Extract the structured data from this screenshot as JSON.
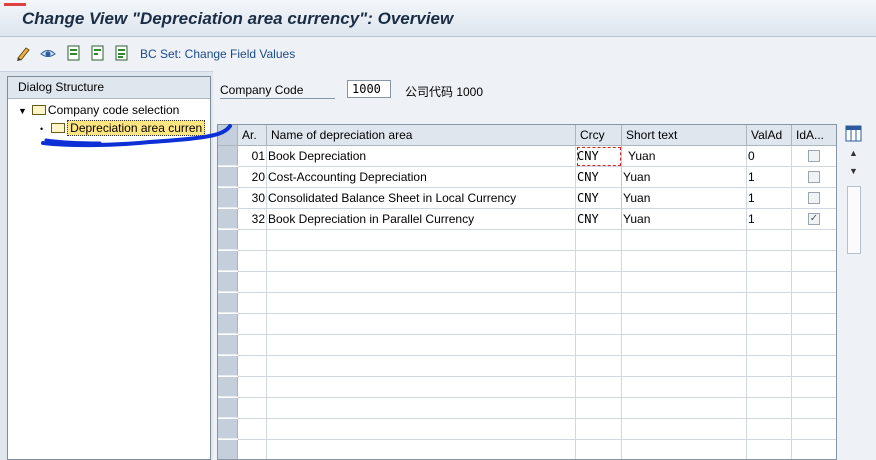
{
  "window": {
    "title": "Change View \"Depreciation area currency\": Overview"
  },
  "toolbar": {
    "bc_set_label": "BC Set: Change Field Values"
  },
  "tree": {
    "header": "Dialog Structure",
    "items": [
      {
        "label": "Company code selection",
        "expanded": true,
        "level": 0
      },
      {
        "label": "Depreciation area curren",
        "selected": true,
        "level": 1
      }
    ]
  },
  "company": {
    "label": "Company Code",
    "value": "1000",
    "name": "公司代码 1000"
  },
  "table": {
    "columns": [
      "Ar.",
      "Name of depreciation area",
      "Crcy",
      "Short text",
      "ValAd",
      "IdA..."
    ],
    "rows": [
      {
        "area": "01",
        "name": "Book Depreciation",
        "crcy": "CNY",
        "short": "Yuan",
        "valad": "0",
        "ida": false
      },
      {
        "area": "20",
        "name": "Cost-Accounting Depreciation",
        "crcy": "CNY",
        "short": "Yuan",
        "valad": "1",
        "ida": false
      },
      {
        "area": "30",
        "name": "Consolidated Balance Sheet in Local Currency",
        "crcy": "CNY",
        "short": "Yuan",
        "valad": "1",
        "ida": false
      },
      {
        "area": "32",
        "name": "Book Depreciation in Parallel Currency",
        "crcy": "CNY",
        "short": "Yuan",
        "valad": "1",
        "ida": true
      }
    ]
  },
  "colors": {
    "title": "#1a2d44",
    "link": "#1b4a8a",
    "selection": "#ffe680",
    "ink": "#0d2fd6"
  }
}
